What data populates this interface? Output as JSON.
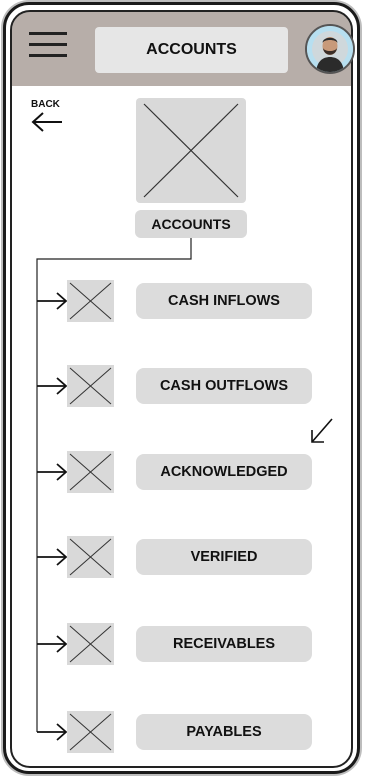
{
  "header": {
    "title": "ACCOUNTS",
    "menu_icon": "hamburger-icon",
    "avatar_icon": "user-avatar"
  },
  "back": {
    "label": "BACK",
    "icon": "arrow-left-icon"
  },
  "hero": {
    "image_icon": "image-placeholder-icon",
    "label": "ACCOUNTS"
  },
  "items": [
    {
      "label": "CASH INFLOWS"
    },
    {
      "label": "CASH OUTFLOWS"
    },
    {
      "label": "ACKNOWLEDGED"
    },
    {
      "label": "VERIFIED"
    },
    {
      "label": "RECEIVABLES"
    },
    {
      "label": "PAYABLES"
    }
  ]
}
